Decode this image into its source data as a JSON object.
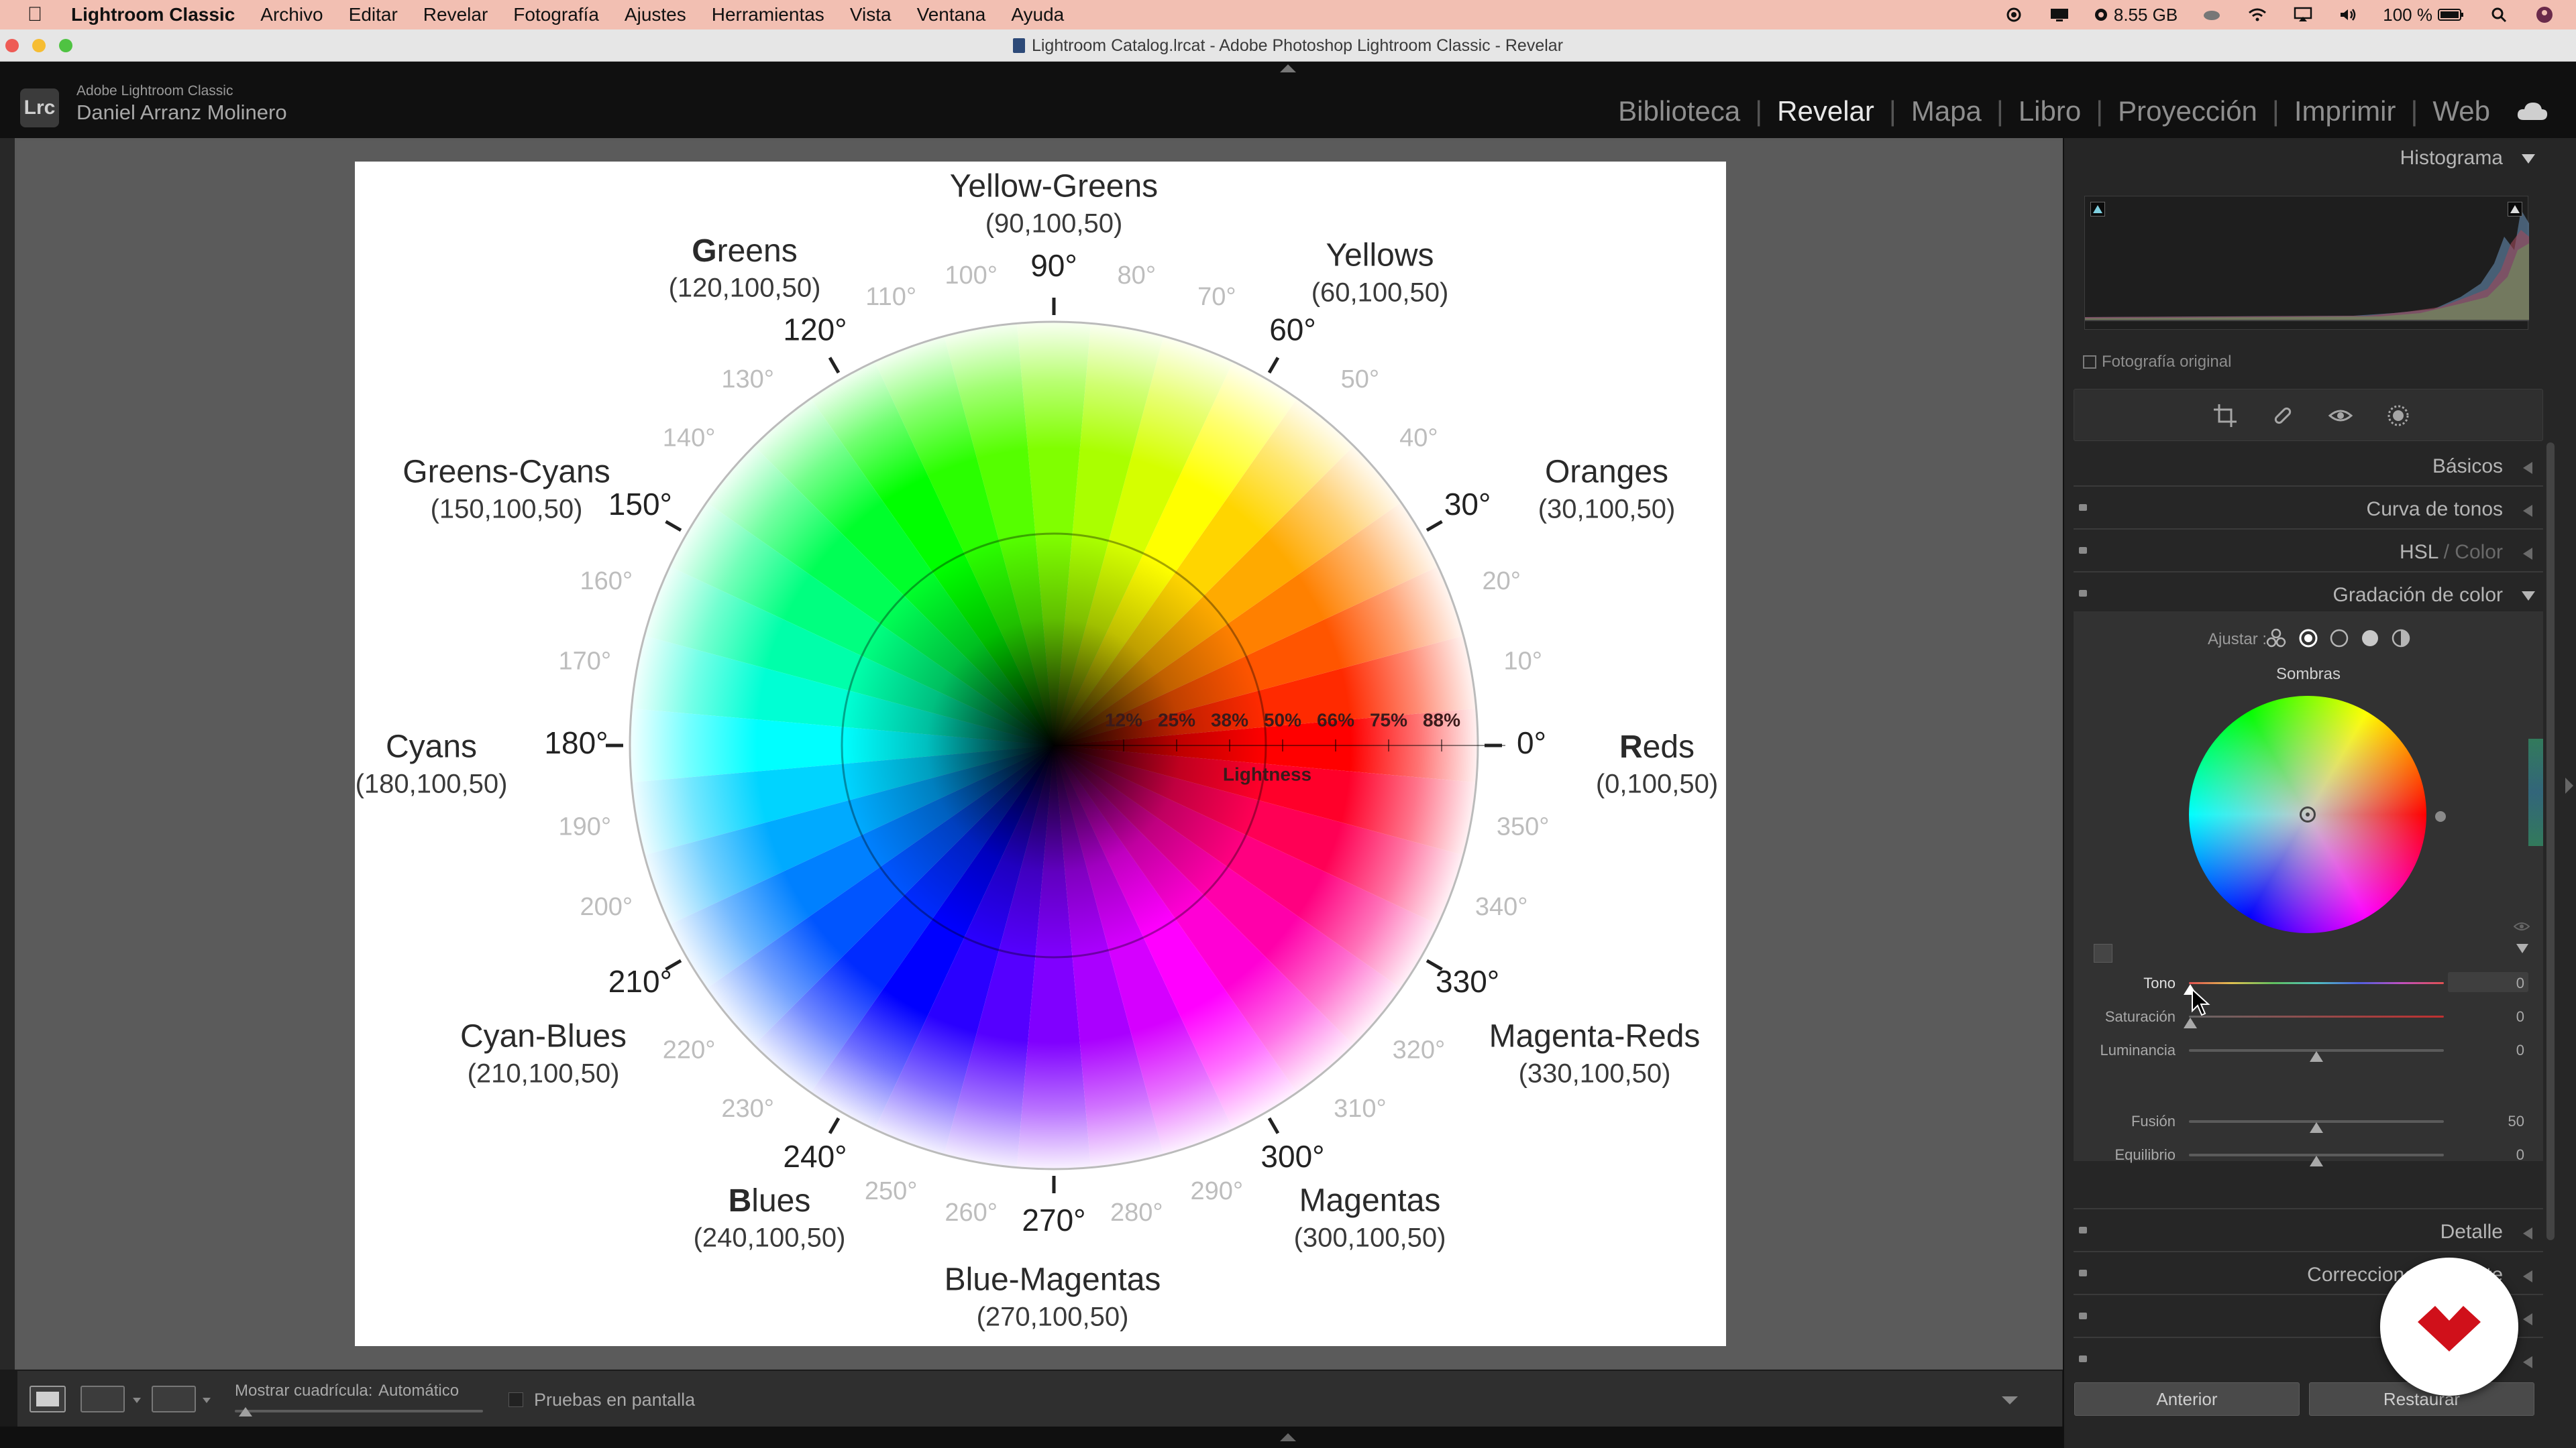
{
  "menubar": {
    "app_name": "Lightroom Classic",
    "items": [
      "Archivo",
      "Editar",
      "Revelar",
      "Fotografía",
      "Ajustes",
      "Herramientas",
      "Vista",
      "Ventana",
      "Ayuda"
    ],
    "memory": "8.55 GB",
    "battery": "100 %"
  },
  "window": {
    "title": "Lightroom Catalog.lrcat - Adobe Photoshop Lightroom Classic - Revelar"
  },
  "identity": {
    "logo_text": "Lrc",
    "product": "Adobe Lightroom Classic",
    "user": "Daniel Arranz Molinero"
  },
  "modules": [
    "Biblioteca",
    "Revelar",
    "Mapa",
    "Libro",
    "Proyección",
    "Imprimir",
    "Web"
  ],
  "active_module": "Revelar",
  "colorwheel_figure": {
    "labels": [
      {
        "name": "Yellow-Greens",
        "code": "(90,100,50)"
      },
      {
        "name": "Greens",
        "code": "(120,100,50)"
      },
      {
        "name": "Yellows",
        "code": "(60,100,50)"
      },
      {
        "name": "Greens-Cyans",
        "code": "(150,100,50)"
      },
      {
        "name": "Oranges",
        "code": "(30,100,50)"
      },
      {
        "name": "Cyans",
        "code": "(180,100,50)"
      },
      {
        "name": "Reds",
        "code": "(0,100,50)"
      },
      {
        "name": "Cyan-Blues",
        "code": "(210,100,50)"
      },
      {
        "name": "Magenta-Reds",
        "code": "(330,100,50)"
      },
      {
        "name": "Blues",
        "code": "(240,100,50)"
      },
      {
        "name": "Magentas",
        "code": "(300,100,50)"
      },
      {
        "name": "Blue-Magentas",
        "code": "(270,100,50)"
      }
    ],
    "major_degrees": [
      "0°",
      "30°",
      "60°",
      "90°",
      "120°",
      "150°",
      "180°",
      "210°",
      "240°",
      "270°",
      "300°",
      "330°"
    ],
    "minor_degrees": [
      "10°",
      "20°",
      "40°",
      "50°",
      "70°",
      "80°",
      "100°",
      "110°",
      "130°",
      "140°",
      "160°",
      "170°",
      "190°",
      "200°",
      "220°",
      "230°",
      "250°",
      "260°",
      "280°",
      "290°",
      "310°",
      "320°",
      "340°",
      "350°"
    ],
    "lightness_ticks": [
      "12%",
      "25%",
      "38%",
      "50%",
      "66%",
      "75%",
      "88%"
    ],
    "lightness_label": "Lightness"
  },
  "toolbar": {
    "grid_label": "Mostrar cuadrícula:",
    "grid_value": "Automático",
    "proof_label": "Pruebas en pantalla"
  },
  "right_panel": {
    "histogram_title": "Histograma",
    "original_photo_label": "Fotografía original",
    "sections": {
      "basicos": "Básicos",
      "curva": "Curva de tonos",
      "hsl": "HSL",
      "hsl_color": "Color",
      "gradacion": "Gradación de color",
      "detalle": "Detalle",
      "correccion": "Correcciones de lente"
    },
    "color_grading": {
      "adjust_label": "Ajustar :",
      "wheel_title": "Sombras",
      "sliders": [
        {
          "name": "Tono",
          "value": "0"
        },
        {
          "name": "Saturación",
          "value": "0"
        },
        {
          "name": "Luminancia",
          "value": "0"
        },
        {
          "name": "Fusión",
          "value": "50"
        },
        {
          "name": "Equilibrio",
          "value": "0"
        }
      ]
    },
    "buttons": {
      "previous": "Anterior",
      "reset": "Restaurar"
    }
  },
  "colors": {
    "menubar_bg": "#f2bfb2",
    "panel_bg": "#262626",
    "accent_badge": "#d0101a"
  }
}
